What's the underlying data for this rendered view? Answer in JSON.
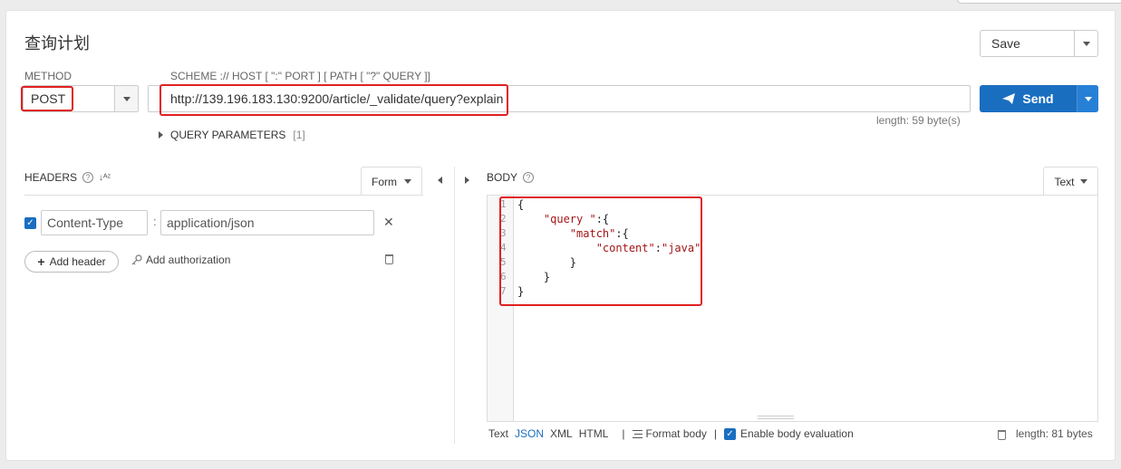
{
  "title": "查询计划",
  "save": {
    "label": "Save"
  },
  "request": {
    "method_label": "METHOD",
    "method": "POST",
    "url_label": "SCHEME :// HOST [ \":\" PORT ] [ PATH [ \"?\" QUERY ]]",
    "url": "http://139.196.183.130:9200/article/_validate/query?explain",
    "url_length": "length: 59 byte(s)",
    "send_label": "Send",
    "query_params_label": "QUERY PARAMETERS",
    "query_params_count": "[1]"
  },
  "headers": {
    "label": "HEADERS",
    "mode": "Form",
    "rows": [
      {
        "enabled": true,
        "key": "Content-Type",
        "value": "application/json"
      }
    ],
    "add_header_label": "Add header",
    "add_auth_label": "Add authorization"
  },
  "body": {
    "label": "BODY",
    "mode": "Text",
    "lines": [
      "{",
      "    \"query \":{",
      "        \"match\":{",
      "            \"content\":\"java\"",
      "        }",
      "    }",
      "}"
    ],
    "formats": [
      "Text",
      "JSON",
      "XML",
      "HTML"
    ],
    "active_format": "JSON",
    "format_body_label": "Format body",
    "eval_label": "Enable body evaluation",
    "eval_enabled": true,
    "length": "length: 81 bytes"
  },
  "colors": {
    "accent": "#1a6ec0",
    "highlight": "#e02020",
    "string": "#a31515"
  },
  "icons": [
    "help-icon",
    "sort-icon",
    "send-icon",
    "key-icon",
    "trash-icon",
    "format-icon"
  ]
}
